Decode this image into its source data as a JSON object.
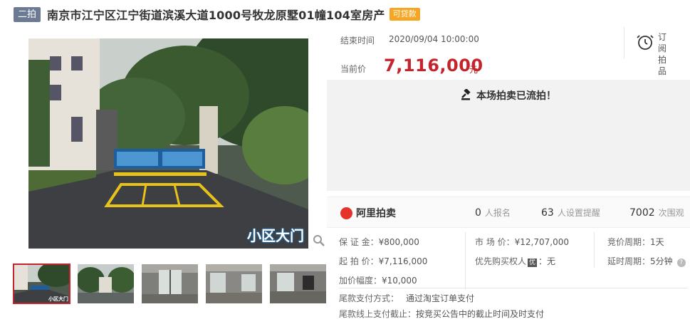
{
  "header": {
    "round_badge": "二拍",
    "title": "南京市江宁区江宁街道滨溪大道1000号牧龙原墅01幢104室房产",
    "loan_badge": "可贷款"
  },
  "gallery": {
    "main_caption": "小区大门",
    "thumb_caption": "小区大门",
    "thumbnail_count": 5
  },
  "auction": {
    "end_time_label": "结束时间",
    "end_time": "2020/09/04 10:00:00",
    "current_price_label": "当前价",
    "current_price": "7,116,000",
    "price_unit": "元",
    "status_message": "本场拍卖已流拍！",
    "subscribe_line1": "订阅",
    "subscribe_line2": "拍品"
  },
  "stats": {
    "platform": "阿里拍卖",
    "signups_value": "0",
    "signups_label": "人报名",
    "reminders_value": "63",
    "reminders_label": "人设置提醒",
    "views_value": "7002",
    "views_label": "次围观"
  },
  "details": {
    "deposit_label": "保 证 金：",
    "deposit": "¥800,000",
    "market_price_label": "市 场 价：",
    "market_price": "¥12,707,000",
    "bid_cycle_label": "竞价周期：",
    "bid_cycle": "1天",
    "start_price_label": "起 拍 价：",
    "start_price": "¥7,116,000",
    "priority_label": "优先购买权人",
    "priority_badge": "优",
    "priority_value": "：无",
    "delay_label": "延时周期：",
    "delay": "5分钟",
    "increment_label": "加价幅度：",
    "increment": "¥10,000",
    "payment_method_label": "尾款支付方式：",
    "payment_method": "通过淘宝订单支付",
    "payment_deadline_label": "尾款线上支付截止：",
    "payment_deadline": "按竞买公告中的截止时间及时支付"
  },
  "colors": {
    "accent_red": "#c4242b",
    "round_badge": "#6c7a94",
    "loan_badge": "#f5a623"
  }
}
